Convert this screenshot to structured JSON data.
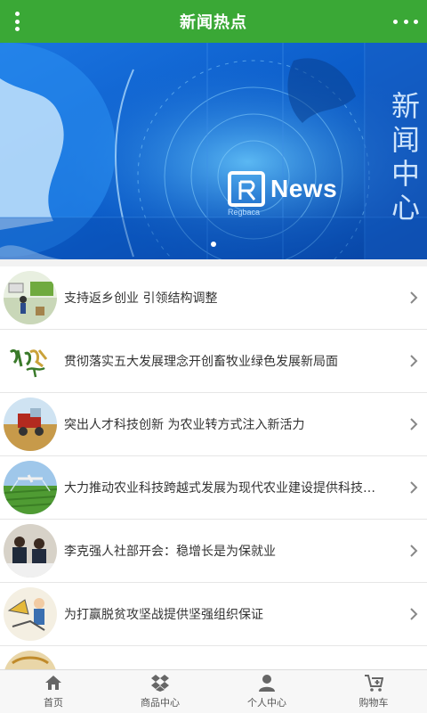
{
  "header": {
    "title": "新闻热点"
  },
  "banner": {
    "side_text": "新闻中心",
    "news_text": "News",
    "brand_text": "Regbaca",
    "slides": 1,
    "active_slide": 0
  },
  "news": [
    {
      "title": "支持返乡创业 引领结构调整",
      "thumb": "rural-entrepreneurship-thumb"
    },
    {
      "title": "贯彻落实五大发展理念开创畜牧业绿色发展新局面",
      "thumb": "calligraphy-thumb"
    },
    {
      "title": "突出人才科技创新 为农业转方式注入新活力",
      "thumb": "harvester-thumb"
    },
    {
      "title": "大力推动农业科技跨越式发展为现代农业建设提供科技支撑",
      "thumb": "crop-duster-thumb"
    },
    {
      "title": "李克强人社部开会：稳增长是为保就业",
      "thumb": "meeting-thumb"
    },
    {
      "title": "为打赢脱贫攻坚战提供坚强组织保证",
      "thumb": "poverty-alleviation-thumb"
    },
    {
      "title": "",
      "thumb": "partial-thumb"
    }
  ],
  "tabbar": {
    "items": [
      {
        "label": "首页",
        "icon": "home-icon"
      },
      {
        "label": "商品中心",
        "icon": "dropbox-icon"
      },
      {
        "label": "个人中心",
        "icon": "user-icon"
      },
      {
        "label": "购物车",
        "icon": "cart-icon"
      }
    ]
  },
  "colors": {
    "header_green": "#3aa836",
    "banner_blue": "#0b56c2"
  }
}
